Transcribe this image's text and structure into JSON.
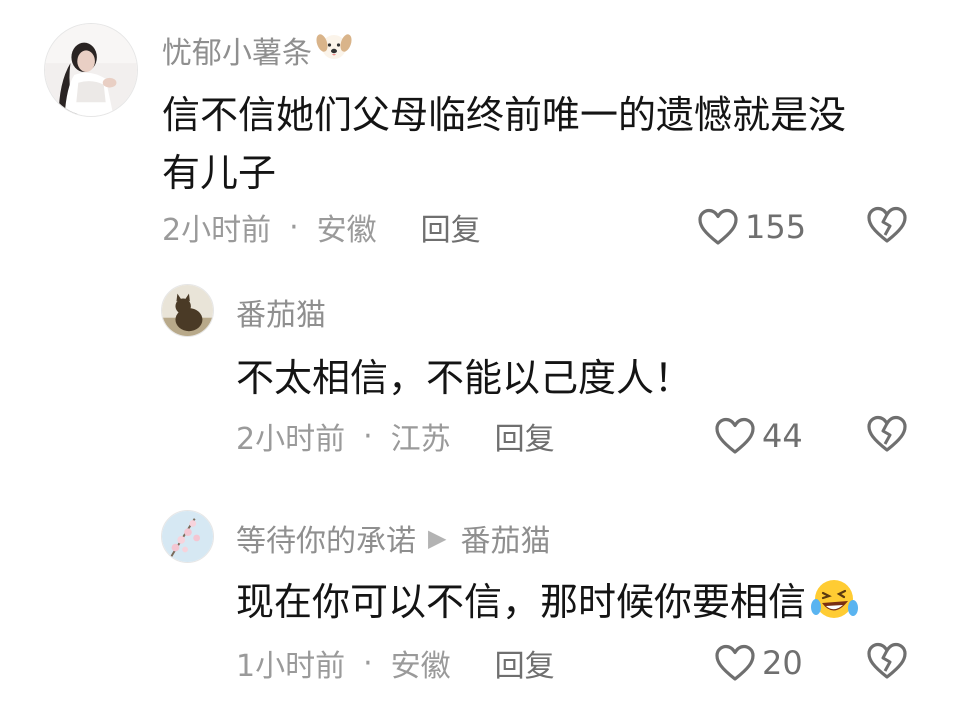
{
  "comments": [
    {
      "username": "忧郁小薯条",
      "username_emoji": "dog-face-icon",
      "text_line1": "信不信她们父母临终前唯一的遗憾就是没",
      "text_line2": "有儿子",
      "time": "2小时前",
      "location": "安徽",
      "reply_label": "回复",
      "likes": "155"
    },
    {
      "username": "番茄猫",
      "text_line1": "不太相信，不能以己度人！",
      "time": "2小时前",
      "location": "江苏",
      "reply_label": "回复",
      "likes": "44"
    },
    {
      "username": "等待你的承诺",
      "reply_to": "番茄猫",
      "text_line1": "现在你可以不信，那时候你要相信",
      "text_emoji": "rolling-laughing-emoji",
      "time": "1小时前",
      "location": "安徽",
      "reply_label": "回复",
      "likes": "20"
    }
  ],
  "separator": "·",
  "colors": {
    "text": "#141414",
    "secondary": "#8f8f8f",
    "action": "#6f6f6f"
  }
}
